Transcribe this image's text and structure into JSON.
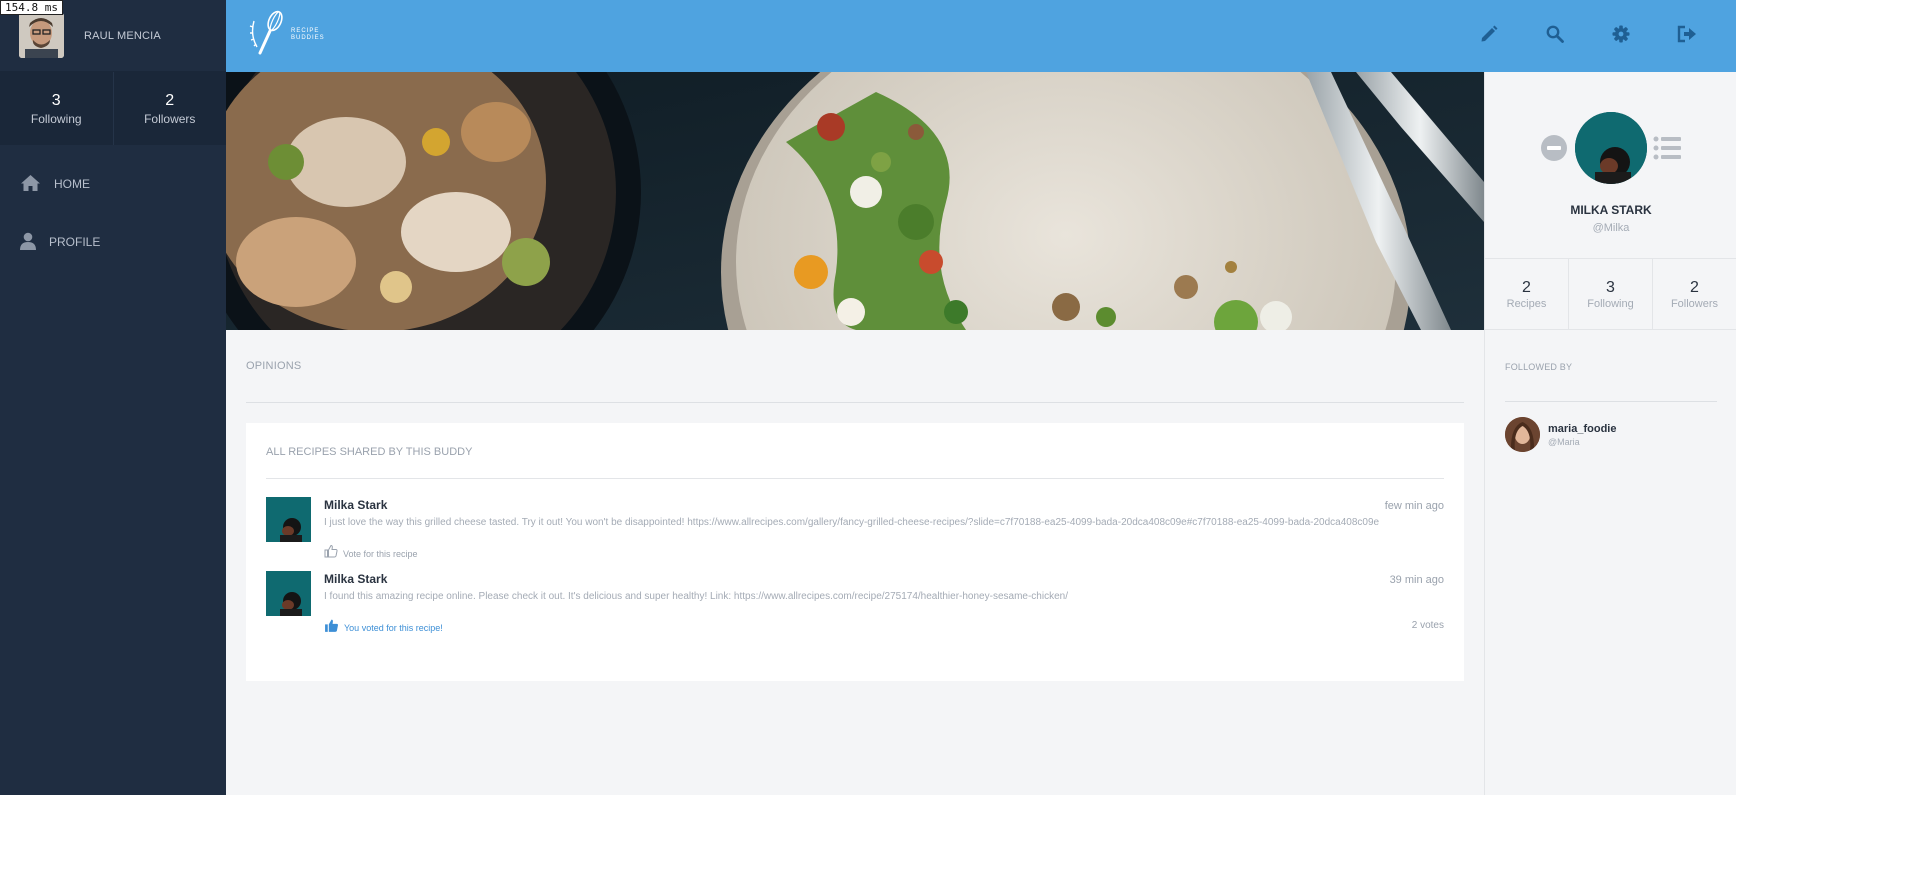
{
  "perf_badge": "154.8 ms",
  "current_user": {
    "name": "RAUL MENCIA",
    "stats": [
      {
        "value": "3",
        "label": "Following"
      },
      {
        "value": "2",
        "label": "Followers"
      }
    ]
  },
  "nav": {
    "home": "HOME",
    "profile": "PROFILE"
  },
  "topbar": {
    "logo_text_1": "RECIPE",
    "logo_text_2": "BUDDIES",
    "icons": [
      "pencil-icon",
      "search-icon",
      "gear-icon",
      "logout-icon"
    ],
    "accent": "#4fa3e0"
  },
  "opinions": {
    "title": "OPINIONS",
    "card_title": "ALL RECIPES SHARED BY THIS BUDDY",
    "posts": [
      {
        "author": "Milka Stark",
        "time": "few min ago",
        "text": "I just love the way this grilled cheese tasted. Try it out! You won't be disappointed! https://www.allrecipes.com/gallery/fancy-grilled-cheese-recipes/?slide=c7f70188-ea25-4099-bada-20dca408c09e#c7f70188-ea25-4099-bada-20dca408c09e",
        "vote_label": "Vote for this recipe",
        "voted": false,
        "votes": ""
      },
      {
        "author": "Milka Stark",
        "time": "39 min ago",
        "text": "I found this amazing recipe online. Please check it out. It's delicious and super healthy! Link: https://www.allrecipes.com/recipe/275174/healthier-honey-sesame-chicken/",
        "vote_label": "You voted for this recipe!",
        "voted": true,
        "votes": "2 votes"
      }
    ]
  },
  "profile": {
    "name": "MILKA STARK",
    "handle": "@Milka",
    "stats": [
      {
        "value": "2",
        "label": "Recipes"
      },
      {
        "value": "3",
        "label": "Following"
      },
      {
        "value": "2",
        "label": "Followers"
      }
    ],
    "followed_by_title": "FOLLOWED BY",
    "followers": [
      {
        "name": "maria_foodie",
        "handle": "@Maria"
      }
    ]
  }
}
